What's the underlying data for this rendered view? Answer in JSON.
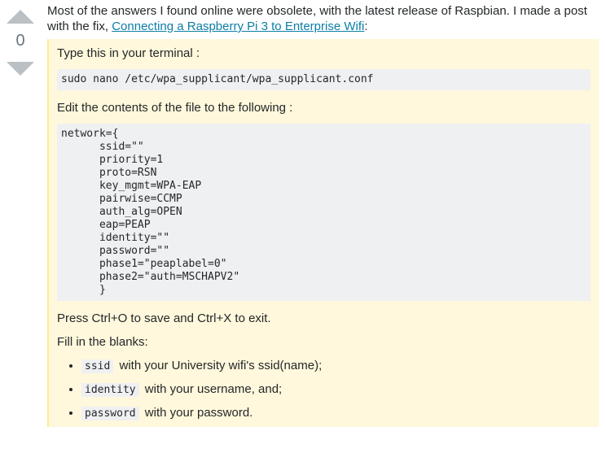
{
  "vote": {
    "count": "0",
    "up_icon": "arrow-up-icon",
    "down_icon": "arrow-down-icon"
  },
  "intro": {
    "text_before": "Most of the answers I found online were obsolete, with the latest release of Raspbian. I made a post with the fix, ",
    "link_text": "Connecting a Raspberry Pi 3 to Enterprise Wifi",
    "text_after": ":"
  },
  "quote": {
    "step1_text": "Type this in your terminal :",
    "command": "sudo nano /etc/wpa_supplicant/wpa_supplicant.conf",
    "step2_text": "Edit the contents of the file to the following :",
    "config_block": "network={\n      ssid=\"\"\n      priority=1\n      proto=RSN\n      key_mgmt=WPA-EAP\n      pairwise=CCMP\n      auth_alg=OPEN\n      eap=PEAP\n      identity=\"\"\n      password=\"\"\n      phase1=\"peaplabel=0\"\n      phase2=\"auth=MSCHAPV2\"\n      }",
    "save_text": "Press Ctrl+O to save and Ctrl+X to exit.",
    "fill_text": "Fill in the blanks:",
    "blanks": [
      {
        "code": "ssid",
        "text": "with your University wifi's ssid(name);"
      },
      {
        "code": "identity",
        "text": "with your username, and;"
      },
      {
        "code": "password",
        "text": "with your password."
      }
    ]
  },
  "colors": {
    "link": "#0c7ea6",
    "quote_bg": "#fff8dc",
    "quote_border": "#ffeb8e",
    "code_bg": "#eff0f1",
    "vote_arrow": "#bbc0c4"
  }
}
